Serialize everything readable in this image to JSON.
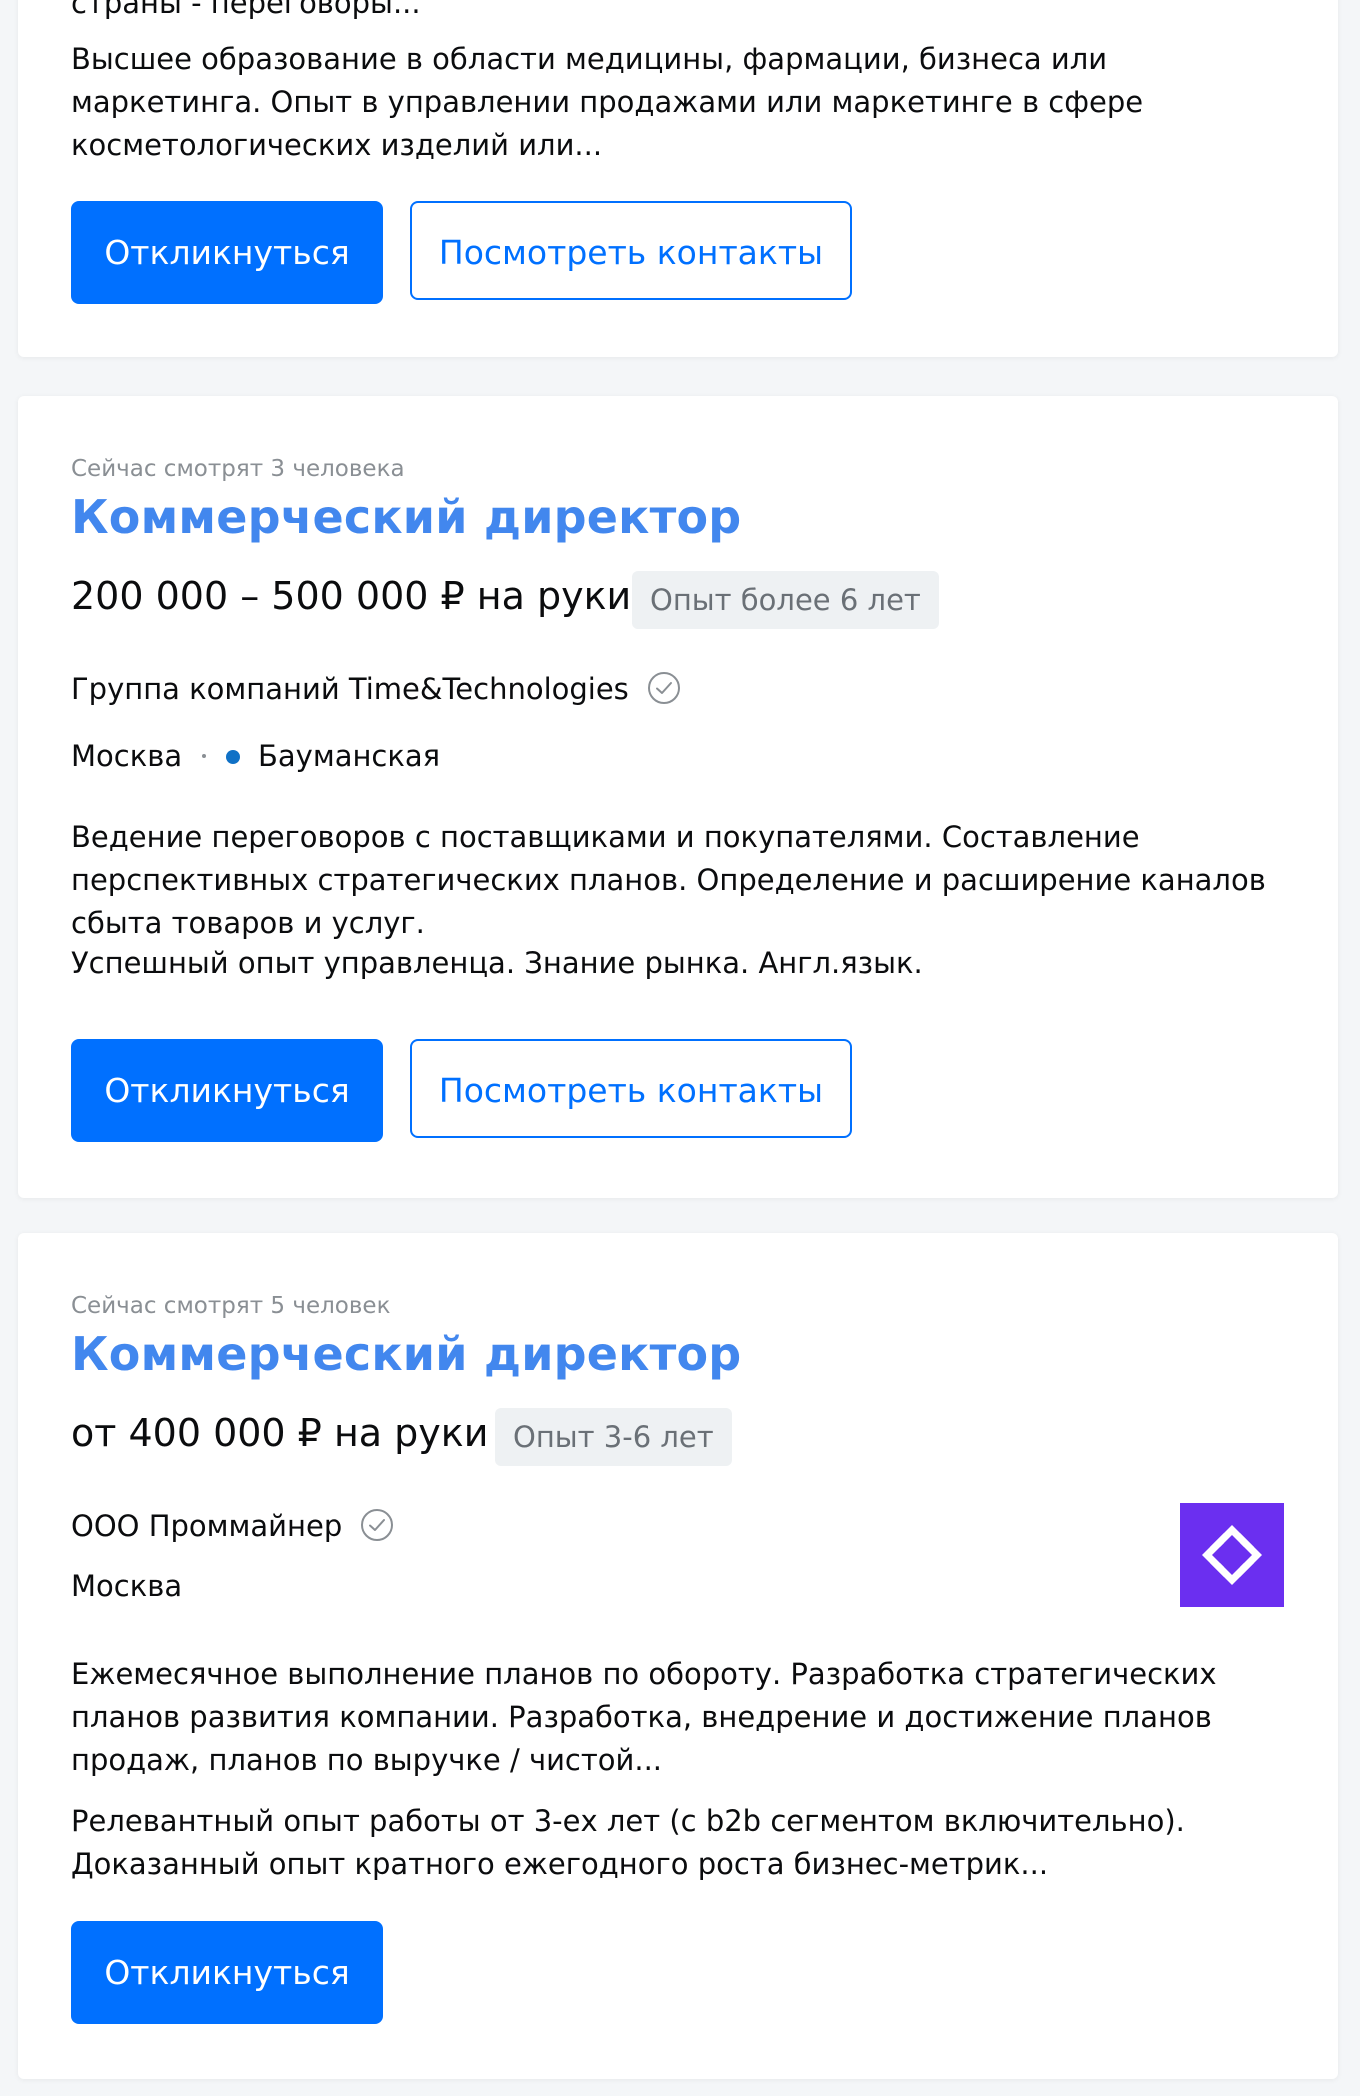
{
  "cards": [
    {
      "cut_text": "страны - переговоры...",
      "requirements": "Высшее образование в области медицины, фармации, бизнеса или маркетинга. Опыт в управлении продажами или маркетинге в сфере косметологических изделий или...",
      "respond_label": "Откликнуться",
      "contacts_label": "Посмотреть контакты"
    },
    {
      "viewers": "Сейчас смотрят 3 человека",
      "title": "Коммерческий директор",
      "salary": "200 000 – 500 000 ₽ на руки",
      "experience": "Опыт более 6 лет",
      "company": "Группа компаний Time&Technologies",
      "city": "Москва",
      "metro": "Бауманская",
      "metro_color": "#1071c6",
      "responsibilities": "Ведение переговоров с поставщиками и покупателями. Составление перспективных стратегических планов. Определение и расширение каналов сбыта товаров и услуг.",
      "requirements": "Успешный опыт управленца. Знание рынка. Англ.язык.",
      "respond_label": "Откликнуться",
      "contacts_label": "Посмотреть контакты"
    },
    {
      "viewers": "Сейчас смотрят 5 человек",
      "title": "Коммерческий директор",
      "salary": "от 400 000 ₽ на руки",
      "experience": "Опыт 3-6 лет",
      "company": "ООО Проммайнер",
      "city": "Москва",
      "logo_icon": "prommainer-logo",
      "logo_color": "#6b2ff0",
      "responsibilities": "Ежемесячное выполнение планов по обороту. Разработка стратегических планов развития компании. Разработка, внедрение и достижение планов продаж, планов по выручке / чистой...",
      "requirements": "Релевантный опыт работы от 3-ех лет (с b2b сегментом включительно). Доказанный опыт кратного ежегодного роста бизнес-метрик...",
      "respond_label": "Откликнуться"
    }
  ],
  "colors": {
    "accent": "#0070ff",
    "title": "#4287ee",
    "muted": "#8a8f94"
  }
}
